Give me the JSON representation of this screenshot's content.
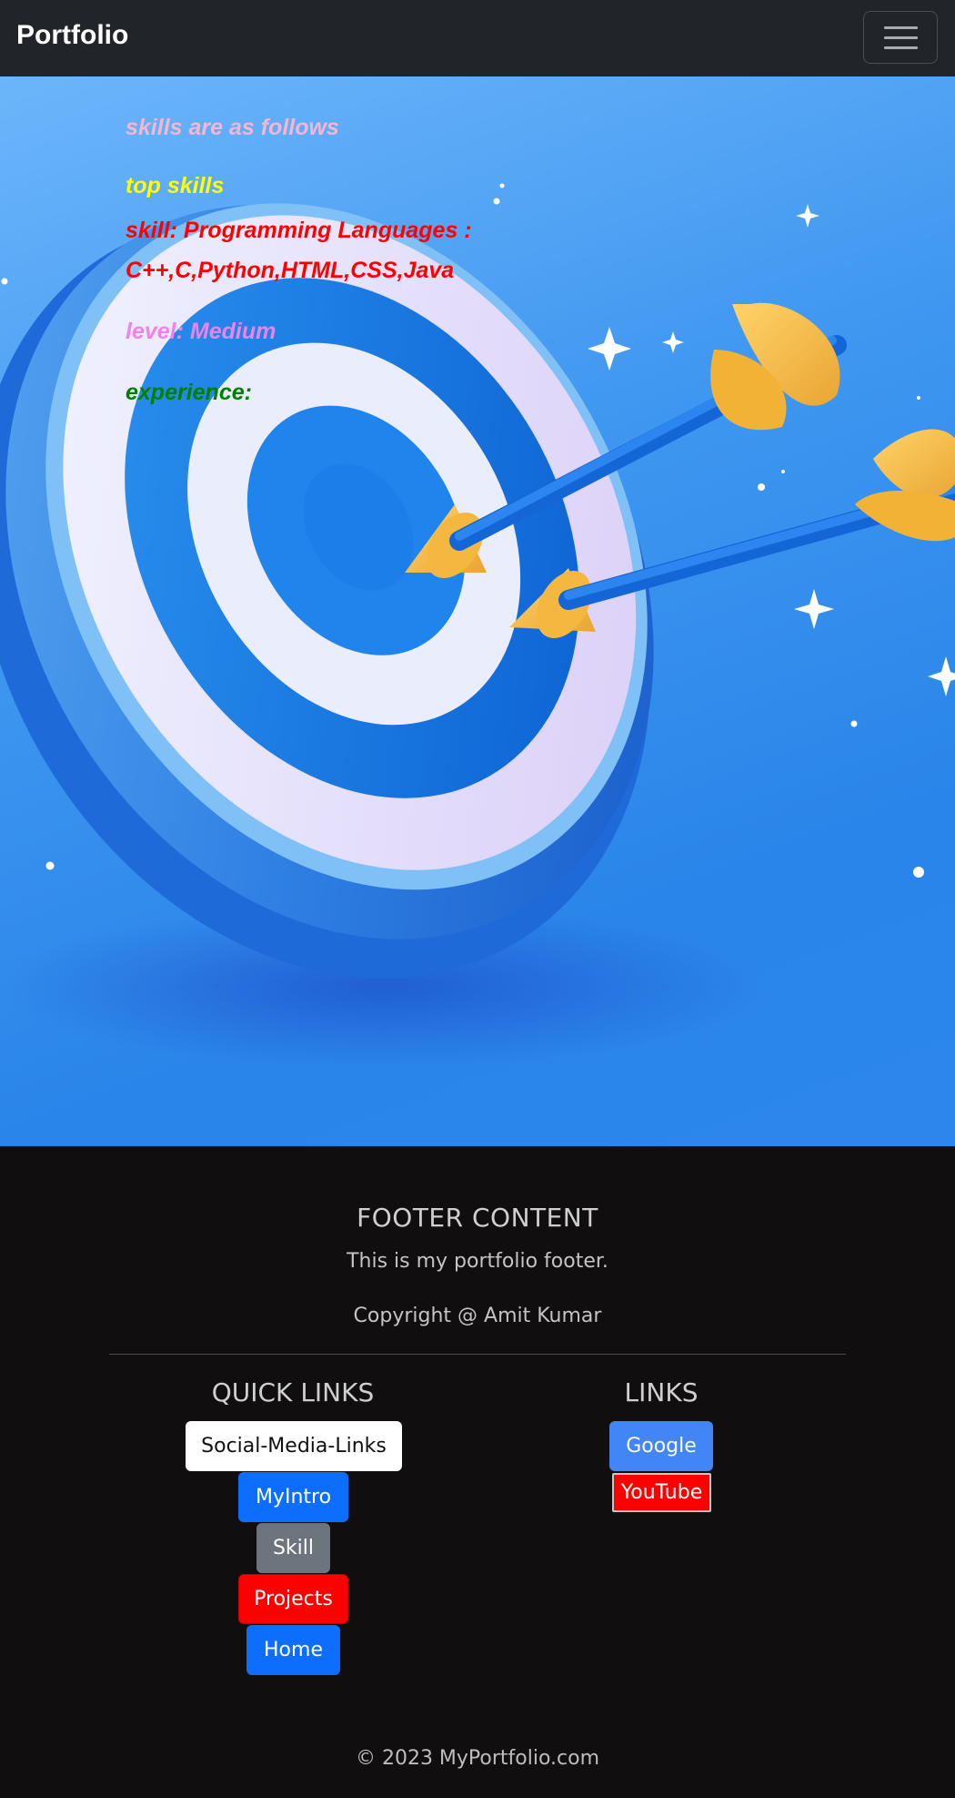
{
  "navbar": {
    "brand": "Portfolio",
    "toggler_icon": "hamburger-menu-icon"
  },
  "hero": {
    "heading": "skills are as follows",
    "top_skills": "top skills",
    "skill_line1": "skill: Programming Languages :",
    "skill_line2": "C++,C,Python,HTML,CSS,Java",
    "level": "level: Medium",
    "experience": "experience:",
    "colors": {
      "heading": "#f5b5d3",
      "top_skills": "#ffff00",
      "skill": "#ff0000",
      "level": "#ee82ee",
      "experience": "#008000"
    }
  },
  "footer": {
    "heading": "FOOTER CONTENT",
    "tagline": "This is my portfolio footer.",
    "copyright_line": "Copyright @ Amit Kumar",
    "quick_links": {
      "title": "QUICK LINKS",
      "buttons": [
        "Social-Media-Links",
        "MyIntro",
        "Skill",
        "Projects",
        "Home"
      ]
    },
    "links": {
      "title": "LINKS",
      "buttons": [
        "Google",
        "YouTube"
      ]
    },
    "bottom_copyright": "© 2023 MyPortfolio.com"
  }
}
